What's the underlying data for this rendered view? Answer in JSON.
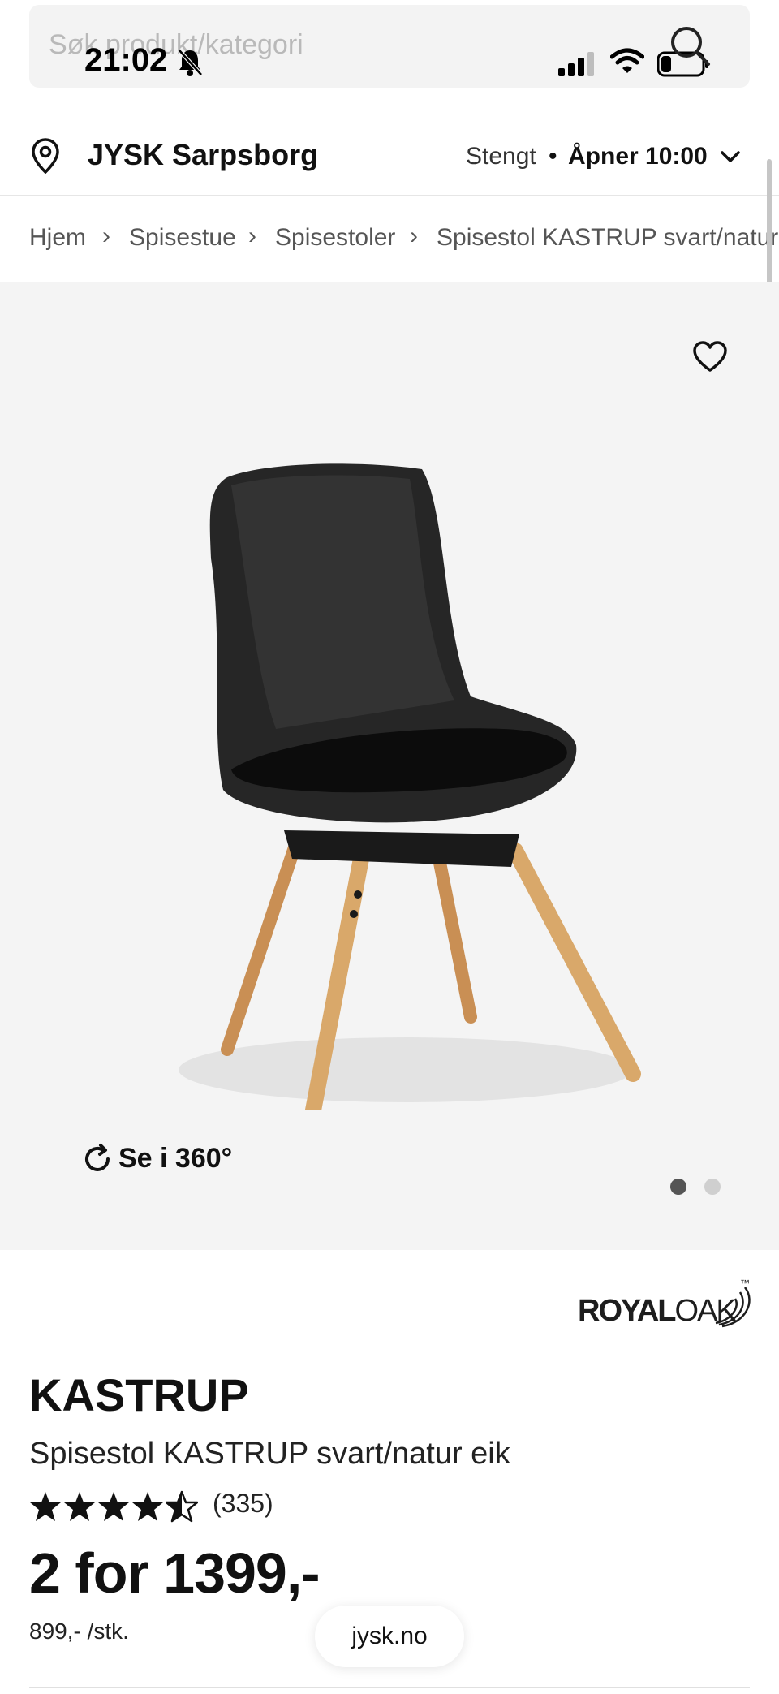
{
  "status_bar": {
    "time": "21:02"
  },
  "search": {
    "placeholder": "Søk produkt/kategori"
  },
  "store": {
    "name": "JYSK Sarpsborg",
    "status": "Stengt",
    "separator": "•",
    "opening": "Åpner 10:00"
  },
  "breadcrumb": [
    {
      "label": "Hjem"
    },
    {
      "label": "Spisestue"
    },
    {
      "label": "Spisestoler"
    },
    {
      "label": "Spisestol KASTRUP svart/natur eik"
    }
  ],
  "gallery": {
    "view360_label": "Se i 360°",
    "image_count": 2,
    "active_index": 0
  },
  "brand": {
    "name_bold": "ROYAL",
    "name_light": "OAK",
    "trademark": "™"
  },
  "product": {
    "name": "KASTRUP",
    "description": "Spisestol KASTRUP svart/natur eik",
    "rating_value": 4.5,
    "rating_max": 5,
    "review_count": "(335)",
    "price": "2 for 1399,-",
    "unit_price": "899,- /stk."
  },
  "browser": {
    "url": "jysk.no"
  },
  "colors": {
    "background": "#ffffff",
    "image_bg": "#f4f4f4",
    "chair_shell": "#222222",
    "chair_wood": "#d9a86a",
    "text": "#111111",
    "muted": "#555555"
  }
}
